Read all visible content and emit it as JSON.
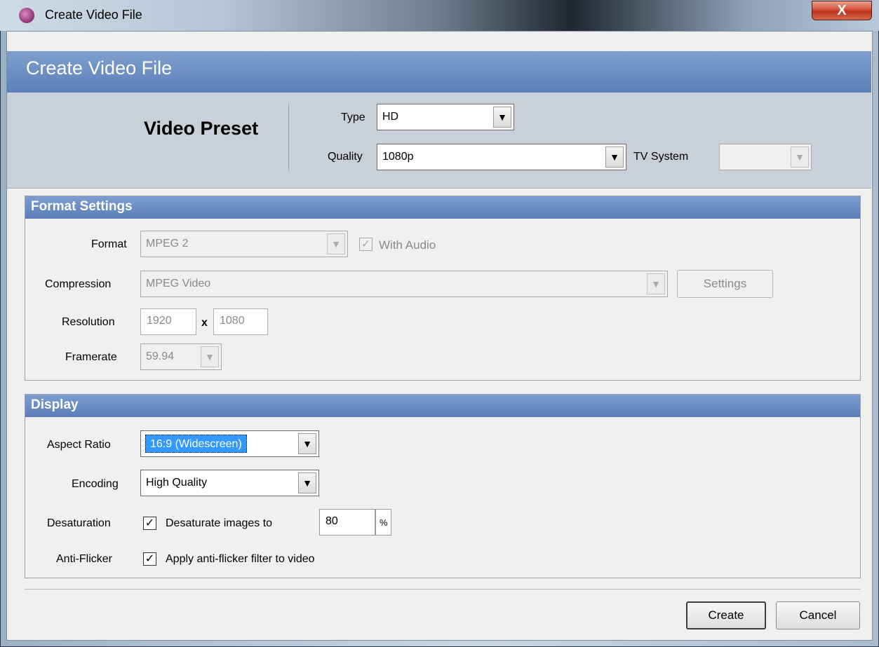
{
  "window": {
    "title": "Create Video File",
    "close_glyph": "X"
  },
  "header": {
    "title": "Create Video File"
  },
  "preset": {
    "title": "Video Preset",
    "type_label": "Type",
    "type_value": "HD",
    "quality_label": "Quality",
    "quality_value": "1080p",
    "tv_system_label": "TV System",
    "tv_system_value": ""
  },
  "format_settings": {
    "title": "Format Settings",
    "format_label": "Format",
    "format_value": "MPEG 2",
    "with_audio_label": "With Audio",
    "with_audio_checked": true,
    "compression_label": "Compression",
    "compression_value": "MPEG Video",
    "settings_button": "Settings",
    "resolution_label": "Resolution",
    "resolution_width": "1920",
    "resolution_separator": "x",
    "resolution_height": "1080",
    "framerate_label": "Framerate",
    "framerate_value": "59.94"
  },
  "display": {
    "title": "Display",
    "aspect_label": "Aspect Ratio",
    "aspect_value": "16:9 (Widescreen)",
    "encoding_label": "Encoding",
    "encoding_value": "High Quality",
    "desaturation_label": "Desaturation",
    "desaturate_text": "Desaturate images to",
    "desaturate_value": "80",
    "desaturate_unit": "%",
    "antiflicker_label": "Anti-Flicker",
    "antiflicker_text": "Apply anti-flicker filter to video"
  },
  "footer": {
    "create_button": "Create",
    "cancel_button": "Cancel"
  },
  "icons": {
    "dropdown": "chevron-down-icon",
    "check": "checkmark-icon",
    "app": "app-logo-icon"
  },
  "colors": {
    "banner": "#5b7fb8",
    "selection": "#3399ff",
    "close": "#c9432a"
  }
}
